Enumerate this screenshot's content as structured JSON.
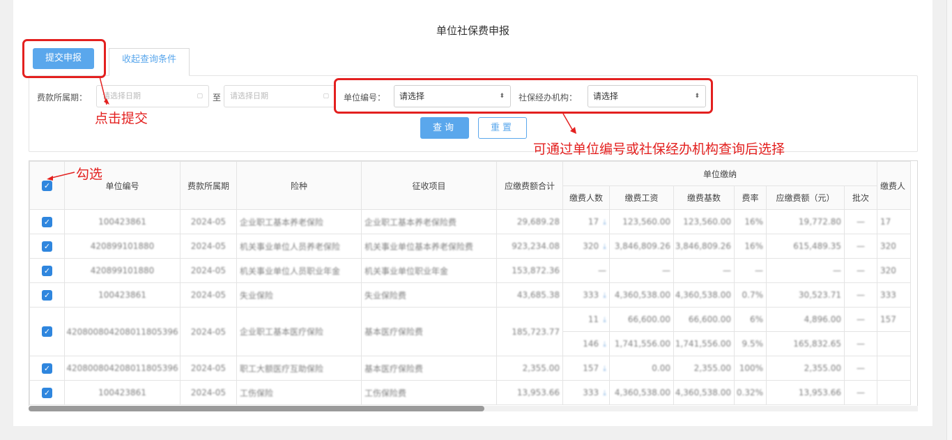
{
  "page": {
    "title": "单位社保费申报"
  },
  "toolbar": {
    "submit_label": "提交申报",
    "collapse_tab_label": "收起查询条件"
  },
  "filters": {
    "period_label": "费款所属期：",
    "start_placeholder": "请选择日期",
    "to_label": "至",
    "end_placeholder": "请选择日期",
    "unit_code_label": "单位编号：",
    "unit_code_value": "请选择",
    "agency_label": "社保经办机构：",
    "agency_value": "请选择",
    "query_label": "查询",
    "reset_label": "重置"
  },
  "annotations": {
    "click_submit": "点击提交",
    "select_hint": "可通过单位编号或社保经办机构查询后选择",
    "check_hint": "勾选"
  },
  "table": {
    "headers": {
      "unit_code": "单位编号",
      "period": "费款所属期",
      "insurance": "险种",
      "item": "征收项目",
      "total": "应缴费额合计",
      "group": "单位缴纳",
      "payers": "缴费人数",
      "wage": "缴费工资",
      "base": "缴费基数",
      "rate": "费率",
      "amount": "应缴费额（元）",
      "batch": "批次",
      "payers2": "缴费人"
    },
    "rows": [
      {
        "checked": true,
        "unit_code": "100423861",
        "period": "2024-05",
        "insurance": "企业职工基本养老保险",
        "item": "企业职工基本养老保险费",
        "total": "29,689.28",
        "payers": "17",
        "wage": "123,560.00",
        "base": "123,560.00",
        "rate": "16%",
        "amount": "19,772.80",
        "batch": "—",
        "payers2": "17"
      },
      {
        "checked": true,
        "unit_code": "420899101880",
        "period": "2024-05",
        "insurance": "机关事业单位人员养老保险",
        "item": "机关事业单位基本养老保险费",
        "total": "923,234.08",
        "payers": "320",
        "wage": "3,846,809.26",
        "base": "3,846,809.26",
        "rate": "16%",
        "amount": "615,489.35",
        "batch": "—",
        "payers2": "320"
      },
      {
        "checked": true,
        "unit_code": "420899101880",
        "period": "2024-05",
        "insurance": "机关事业单位人员职业年金",
        "item": "机关事业单位职业年金",
        "total": "153,872.36",
        "payers": "—",
        "wage": "—",
        "base": "—",
        "rate": "—",
        "amount": "—",
        "batch": "—",
        "payers2": "320"
      },
      {
        "checked": true,
        "unit_code": "100423861",
        "period": "2024-05",
        "insurance": "失业保险",
        "item": "失业保险费",
        "total": "43,685.38",
        "payers": "333",
        "wage": "4,360,538.00",
        "base": "4,360,538.00",
        "rate": "0.7%",
        "amount": "30,523.71",
        "batch": "—",
        "payers2": "333"
      },
      {
        "checked": true,
        "unit_code": "420800804208011805396",
        "period": "2024-05",
        "insurance": "企业职工基本医疗保险",
        "item": "基本医疗保险费",
        "total": "185,723.77",
        "sub": [
          {
            "payers": "11",
            "wage": "66,600.00",
            "base": "66,600.00",
            "rate": "6%",
            "amount": "4,896.00",
            "batch": "—",
            "payers2": "157"
          },
          {
            "payers": "146",
            "wage": "1,741,556.00",
            "base": "1,741,556.00",
            "rate": "9.5%",
            "amount": "165,832.65",
            "batch": "—",
            "payers2": ""
          }
        ]
      },
      {
        "checked": true,
        "unit_code": "420800804208011805396",
        "period": "2024-05",
        "insurance": "职工大额医疗互助保险",
        "item": "基本医疗保险费",
        "total": "2,355.00",
        "payers": "157",
        "wage": "0.00",
        "base": "2,355.00",
        "rate": "100%",
        "amount": "2,355.00",
        "batch": "—",
        "payers2": ""
      },
      {
        "checked": true,
        "unit_code": "100423861",
        "period": "2024-05",
        "insurance": "工伤保险",
        "item": "工伤保险费",
        "total": "13,953.66",
        "payers": "333",
        "wage": "4,360,538.00",
        "base": "4,360,538.00",
        "rate": "0.32%",
        "amount": "13,953.66",
        "batch": "—",
        "payers2": ""
      }
    ]
  }
}
